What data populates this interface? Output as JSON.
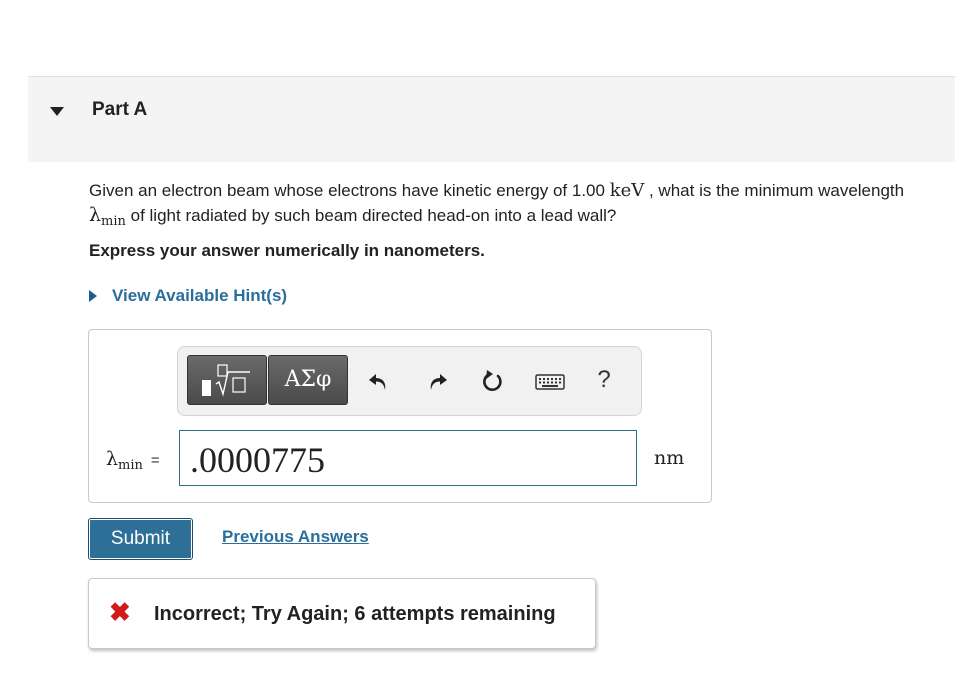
{
  "part": {
    "title": "Part A"
  },
  "question": {
    "text_1": "Given an electron beam whose electrons have kinetic energy of 1.00 ",
    "energy_unit": "keV",
    "text_2": " , what is the minimum wavelength ",
    "symbol": "λ",
    "symbol_subscript": "min",
    "text_3": " of light radiated by such beam directed head-on into a lead wall?",
    "instruction": "Express your answer numerically in nanometers."
  },
  "hint": {
    "label": "View Available Hint(s)"
  },
  "toolbar": {
    "greek_label": "ΑΣφ",
    "help_label": "?",
    "icons": [
      "templates-icon",
      "greek-letters-icon",
      "undo-icon",
      "redo-icon",
      "reset-icon",
      "keyboard-icon",
      "help-icon"
    ]
  },
  "answer": {
    "symbol": "λ",
    "subscript": "min",
    "equals": "=",
    "value": ".0000775",
    "unit": "nm"
  },
  "actions": {
    "submit_label": "Submit",
    "previous_answers_label": "Previous Answers"
  },
  "feedback": {
    "icon": "x-icon",
    "message": "Incorrect; Try Again; 6 attempts remaining",
    "status_color": "#d21a1a"
  },
  "colors": {
    "link": "#2a6e9c",
    "submit_bg": "#2d6f97",
    "header_bg": "#f4f4f4"
  }
}
